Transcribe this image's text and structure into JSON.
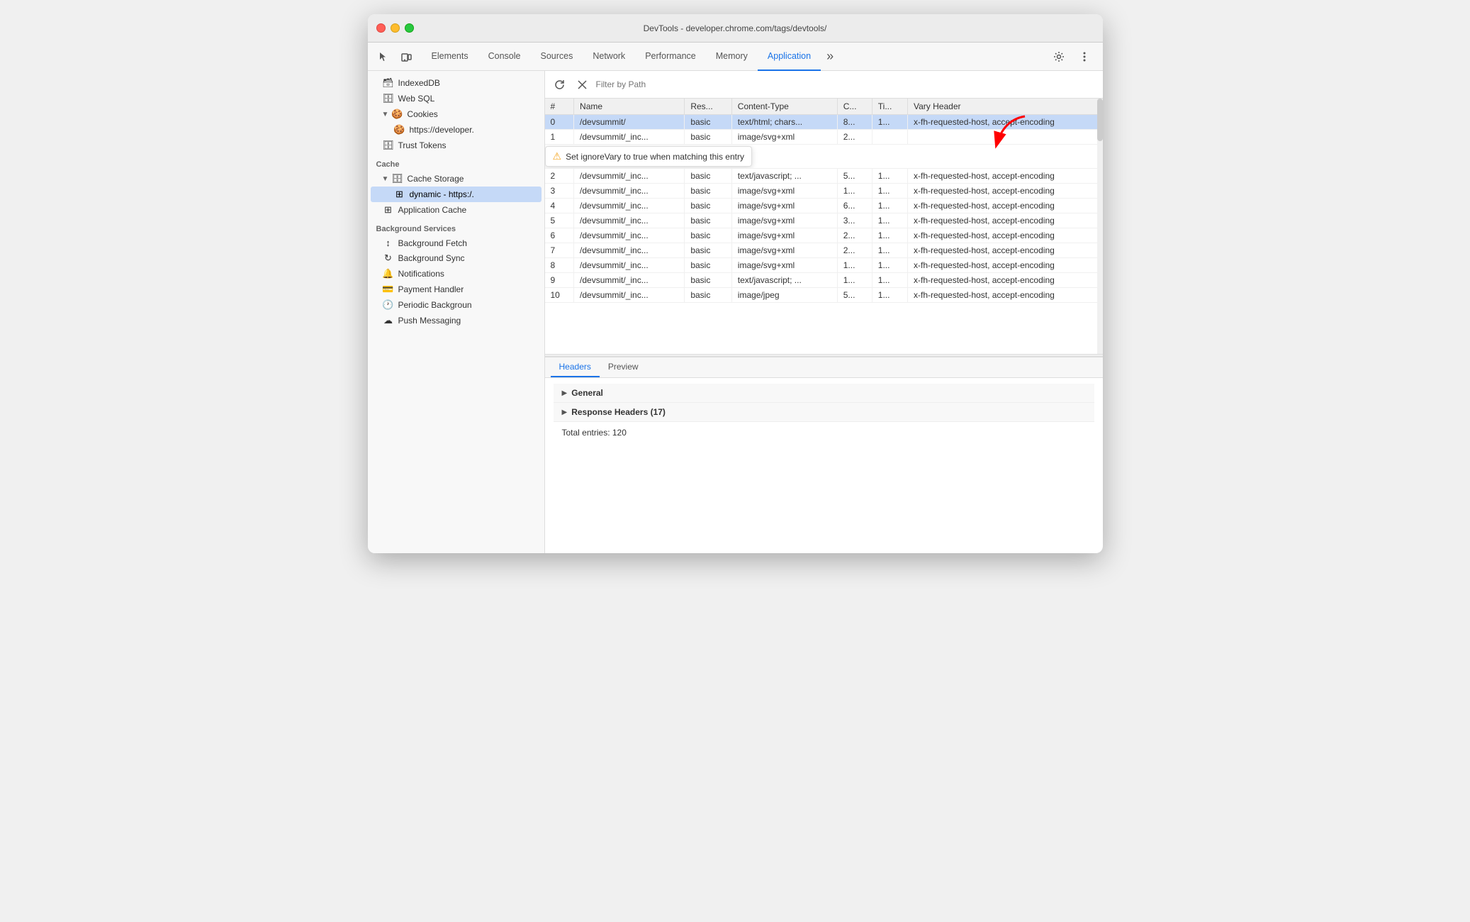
{
  "window": {
    "title": "DevTools - developer.chrome.com/tags/devtools/"
  },
  "tabs": [
    {
      "label": "Elements",
      "active": false
    },
    {
      "label": "Console",
      "active": false
    },
    {
      "label": "Sources",
      "active": false
    },
    {
      "label": "Network",
      "active": false
    },
    {
      "label": "Performance",
      "active": false
    },
    {
      "label": "Memory",
      "active": false
    },
    {
      "label": "Application",
      "active": true
    }
  ],
  "tab_more_label": "»",
  "sidebar": {
    "sections": [
      {
        "items": [
          {
            "label": "IndexedDB",
            "icon": "🗃",
            "indent": 1,
            "has_triangle": false,
            "type": "indexeddb"
          },
          {
            "label": "Web SQL",
            "icon": "🗄",
            "indent": 1,
            "has_triangle": false
          },
          {
            "label": "Cookies",
            "icon": "🍪",
            "indent": 1,
            "has_triangle": true,
            "expanded": true
          },
          {
            "label": "https://developer.",
            "icon": "🍪",
            "indent": 2,
            "has_triangle": false
          },
          {
            "label": "Trust Tokens",
            "icon": "🗄",
            "indent": 1,
            "has_triangle": false
          }
        ]
      },
      {
        "label": "Cache",
        "items": [
          {
            "label": "Cache Storage",
            "icon": "🗄",
            "indent": 1,
            "has_triangle": true,
            "expanded": true
          },
          {
            "label": "dynamic - https:/.",
            "icon": "⊞",
            "indent": 2,
            "has_triangle": false,
            "selected": true
          },
          {
            "label": "Application Cache",
            "icon": "⊞",
            "indent": 1,
            "has_triangle": false
          }
        ]
      },
      {
        "label": "Background Services",
        "items": [
          {
            "label": "Background Fetch",
            "icon": "↕",
            "indent": 1,
            "has_triangle": false
          },
          {
            "label": "Background Sync",
            "icon": "↻",
            "indent": 1,
            "has_triangle": false
          },
          {
            "label": "Notifications",
            "icon": "🔔",
            "indent": 1,
            "has_triangle": false
          },
          {
            "label": "Payment Handler",
            "icon": "💳",
            "indent": 1,
            "has_triangle": false
          },
          {
            "label": "Periodic Backgroun",
            "icon": "🕐",
            "indent": 1,
            "has_triangle": false
          },
          {
            "label": "Push Messaging",
            "icon": "☁",
            "indent": 1,
            "has_triangle": false
          }
        ]
      }
    ]
  },
  "filter": {
    "placeholder": "Filter by Path"
  },
  "table": {
    "columns": [
      "#",
      "Name",
      "Res...",
      "Content-Type",
      "C...",
      "Ti...",
      "Vary Header"
    ],
    "rows": [
      {
        "num": "0",
        "name": "/devsummit/",
        "res": "basic",
        "content_type": "text/html; chars...",
        "c": "8...",
        "ti": "1...",
        "vary": "x-fh-requested-host, accept-encoding",
        "selected": true
      },
      {
        "num": "1",
        "name": "/devsummit/_inc...",
        "res": "basic",
        "content_type": "image/svg+xml",
        "c": "2...",
        "ti": "",
        "vary": "",
        "has_tooltip": true
      },
      {
        "num": "2",
        "name": "/devsummit/_inc...",
        "res": "basic",
        "content_type": "text/javascript; ...",
        "c": "5...",
        "ti": "1...",
        "vary": "x-fh-requested-host, accept-encoding"
      },
      {
        "num": "3",
        "name": "/devsummit/_inc...",
        "res": "basic",
        "content_type": "image/svg+xml",
        "c": "1...",
        "ti": "1...",
        "vary": "x-fh-requested-host, accept-encoding"
      },
      {
        "num": "4",
        "name": "/devsummit/_inc...",
        "res": "basic",
        "content_type": "image/svg+xml",
        "c": "6...",
        "ti": "1...",
        "vary": "x-fh-requested-host, accept-encoding"
      },
      {
        "num": "5",
        "name": "/devsummit/_inc...",
        "res": "basic",
        "content_type": "image/svg+xml",
        "c": "3...",
        "ti": "1...",
        "vary": "x-fh-requested-host, accept-encoding"
      },
      {
        "num": "6",
        "name": "/devsummit/_inc...",
        "res": "basic",
        "content_type": "image/svg+xml",
        "c": "2...",
        "ti": "1...",
        "vary": "x-fh-requested-host, accept-encoding"
      },
      {
        "num": "7",
        "name": "/devsummit/_inc...",
        "res": "basic",
        "content_type": "image/svg+xml",
        "c": "2...",
        "ti": "1...",
        "vary": "x-fh-requested-host, accept-encoding"
      },
      {
        "num": "8",
        "name": "/devsummit/_inc...",
        "res": "basic",
        "content_type": "image/svg+xml",
        "c": "1...",
        "ti": "1...",
        "vary": "x-fh-requested-host, accept-encoding"
      },
      {
        "num": "9",
        "name": "/devsummit/_inc...",
        "res": "basic",
        "content_type": "text/javascript; ...",
        "c": "1...",
        "ti": "1...",
        "vary": "x-fh-requested-host, accept-encoding"
      },
      {
        "num": "10",
        "name": "/devsummit/_inc...",
        "res": "basic",
        "content_type": "image/jpeg",
        "c": "5...",
        "ti": "1...",
        "vary": "x-fh-requested-host, accept-encoding"
      }
    ],
    "tooltip": "Set ignoreVary to true when matching this entry"
  },
  "bottom_panel": {
    "tabs": [
      {
        "label": "Headers",
        "active": true
      },
      {
        "label": "Preview",
        "active": false
      }
    ],
    "sections": [
      {
        "title": "General",
        "collapsed": true
      },
      {
        "title": "Response Headers (17)",
        "collapsed": true
      }
    ],
    "total_entries": "Total entries: 120"
  }
}
